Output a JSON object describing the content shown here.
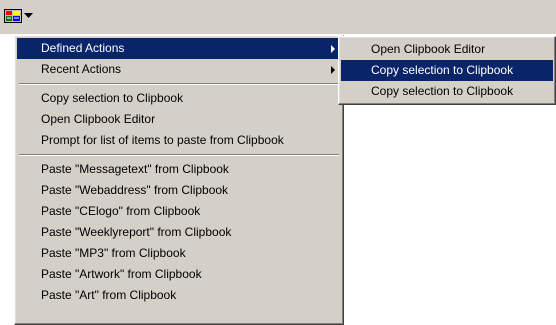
{
  "toolbar": {
    "tray_icon": "clipbook-tray-icon",
    "dropdown_icon": "dropdown-arrow-icon"
  },
  "menu": {
    "submenus": [
      {
        "label": "Defined Actions"
      },
      {
        "label": "Recent Actions"
      }
    ],
    "actions": [
      {
        "label": "Copy selection to Clipbook"
      },
      {
        "label": "Open Clipbook Editor"
      },
      {
        "label": "Prompt for list of items to paste from Clipbook"
      }
    ],
    "paste_items": [
      {
        "label": "Paste \"Messagetext\" from Clipbook"
      },
      {
        "label": "Paste \"Webaddress\" from Clipbook"
      },
      {
        "label": "Paste \"CElogo\" from Clipbook"
      },
      {
        "label": "Paste \"Weeklyreport\" from Clipbook"
      },
      {
        "label": "Paste \"MP3\" from Clipbook"
      },
      {
        "label": "Paste \"Artwork\" from Clipbook"
      },
      {
        "label": "Paste \"Art\" from Clipbook"
      }
    ]
  },
  "submenu": {
    "items": [
      {
        "label": "Open Clipbook Editor"
      },
      {
        "label": "Copy selection to Clipbook"
      },
      {
        "label": "Copy selection to Clipbook"
      }
    ]
  },
  "colors": {
    "menu_bg": "#d4d0c8",
    "highlight": "#0a246a",
    "highlight_text": "#ffffff"
  }
}
